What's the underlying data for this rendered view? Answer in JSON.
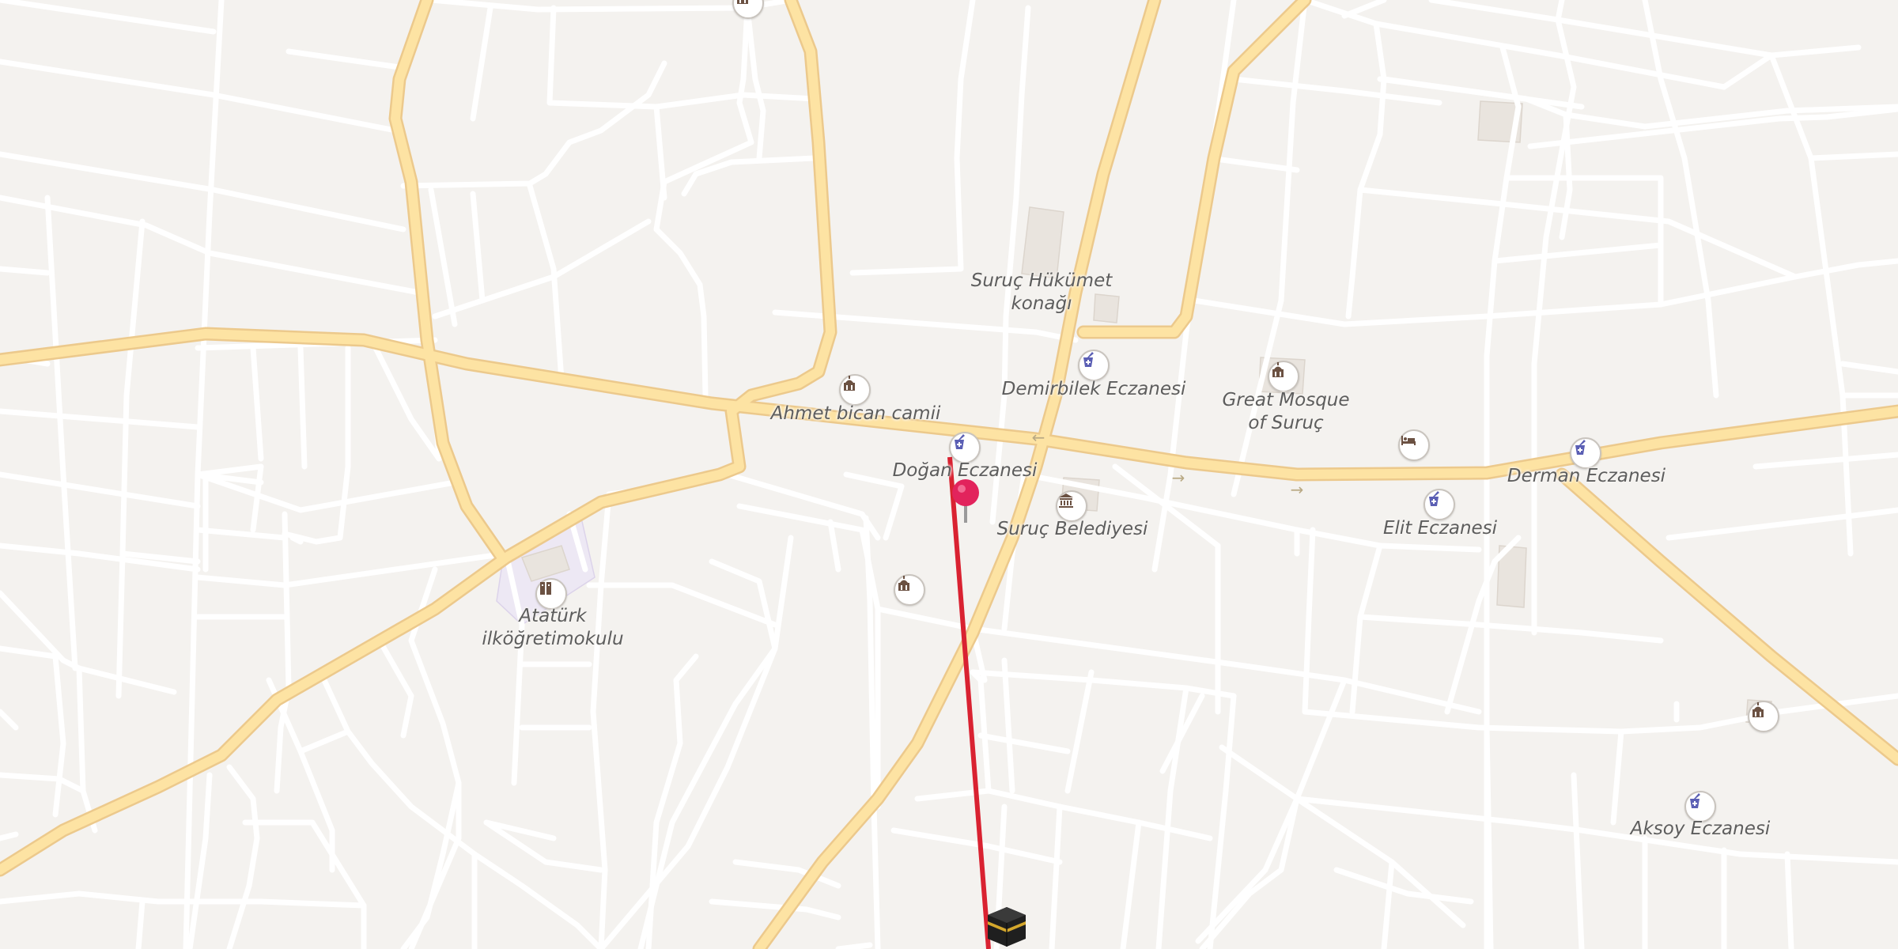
{
  "map": {
    "labels": {
      "hukumet": "Suruç Hükümet\nkonağı",
      "demirbilek": "Demirbilek Eczanesi",
      "great_mosque": "Great Mosque\nof Suruç",
      "ahmet_bican": "Ahmet bican camii",
      "dogan": "Doğan Eczanesi",
      "belediye": "Suruç Belediyesi",
      "elit": "Elit Eczanesi",
      "derman": "Derman Eczanesi",
      "ataturk": "Atatürk\nilköğretimokulu",
      "aksoy": "Aksoy Eczanesi"
    },
    "colors": {
      "background": "#f4f2ef",
      "major_road": "#fde3a3",
      "minor_road": "#ffffff",
      "qibla_line": "#d92231",
      "pin": "#e2235c",
      "pharmacy_icon": "#5b5fb4",
      "mosque_icon": "#6b5142"
    },
    "icons": [
      "mosque-icon",
      "pharmacy-icon",
      "town-hall-icon",
      "hotel-icon",
      "school-icon",
      "kaaba-icon",
      "location-pin-icon",
      "one-way-arrow-icon"
    ]
  }
}
